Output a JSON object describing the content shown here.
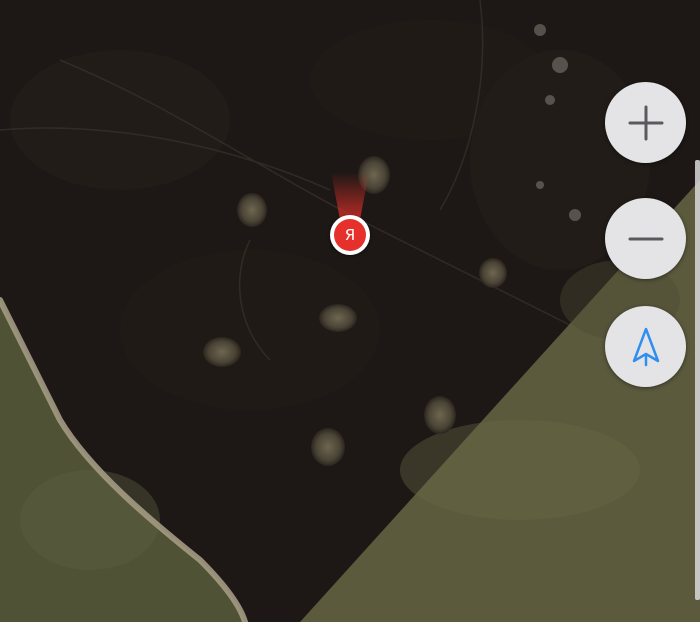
{
  "map": {
    "type": "satellite",
    "colors": {
      "dark_terrain": "#1d1815",
      "light_terrain": "#5b5a3d",
      "shore": "#a39a82",
      "marker_red": "#e5302b",
      "button_bg": "#e4e4e6",
      "icon_gray": "#5a5a5e",
      "navigation_blue": "#2f8ff0"
    }
  },
  "controls": {
    "zoom_in_icon": "plus-icon",
    "zoom_out_icon": "minus-icon",
    "locate_icon": "navigation-arrow-icon"
  },
  "marker": {
    "label": "Я",
    "icon": "user-location-marker",
    "heading_cone": true
  }
}
